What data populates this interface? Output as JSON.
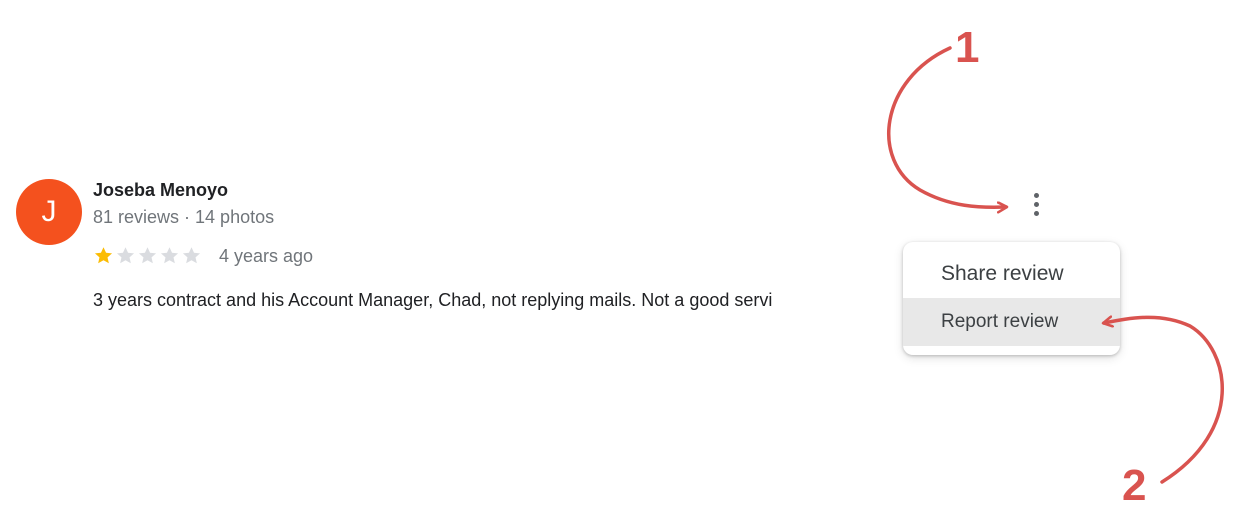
{
  "review": {
    "avatar_letter": "J",
    "avatar_color": "#f4511e",
    "author_name": "Joseba Menoyo",
    "author_meta": "81 reviews · 14 photos",
    "rating": 1,
    "max_rating": 5,
    "star_color": "#fbbc04",
    "star_empty_color": "#dadce0",
    "age": "4 years ago",
    "text": "3 years contract and his Account Manager, Chad, not replying mails. Not a good servi"
  },
  "more_button": {
    "icon": "more-vert-icon"
  },
  "menu": {
    "items": [
      {
        "label": "Share review",
        "highlighted": false
      },
      {
        "label": "Report review",
        "highlighted": true
      }
    ]
  },
  "annotations": {
    "color": "#d9534f",
    "step1_label": "1",
    "step2_label": "2"
  }
}
